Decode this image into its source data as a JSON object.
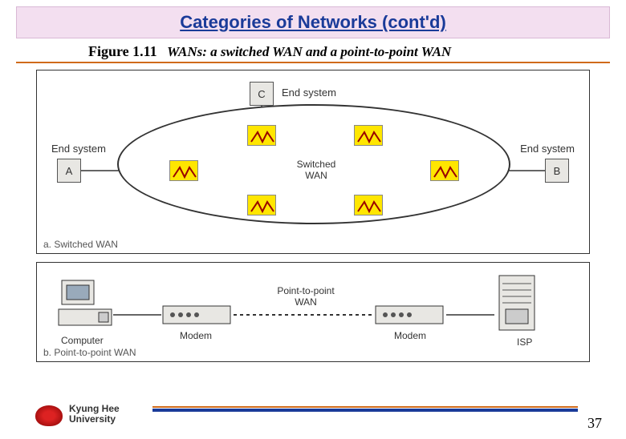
{
  "title": "Categories of Networks (cont'd)",
  "figure_number": "Figure 1.11",
  "figure_caption": "WANs: a switched WAN and a point-to-point WAN",
  "diagram_a": {
    "caption": "a. Switched WAN",
    "hosts": {
      "a": "A",
      "b": "B",
      "c": "C"
    },
    "host_label": "End system",
    "center_label": "Switched\nWAN"
  },
  "diagram_b": {
    "caption": "b. Point-to-point WAN",
    "computer_label": "Computer",
    "modem_label": "Modem",
    "isp_label": "ISP",
    "link_label": "Point-to-point\nWAN"
  },
  "footer": {
    "university_line1": "Kyung Hee",
    "university_line2": "University",
    "page_number": "37"
  }
}
